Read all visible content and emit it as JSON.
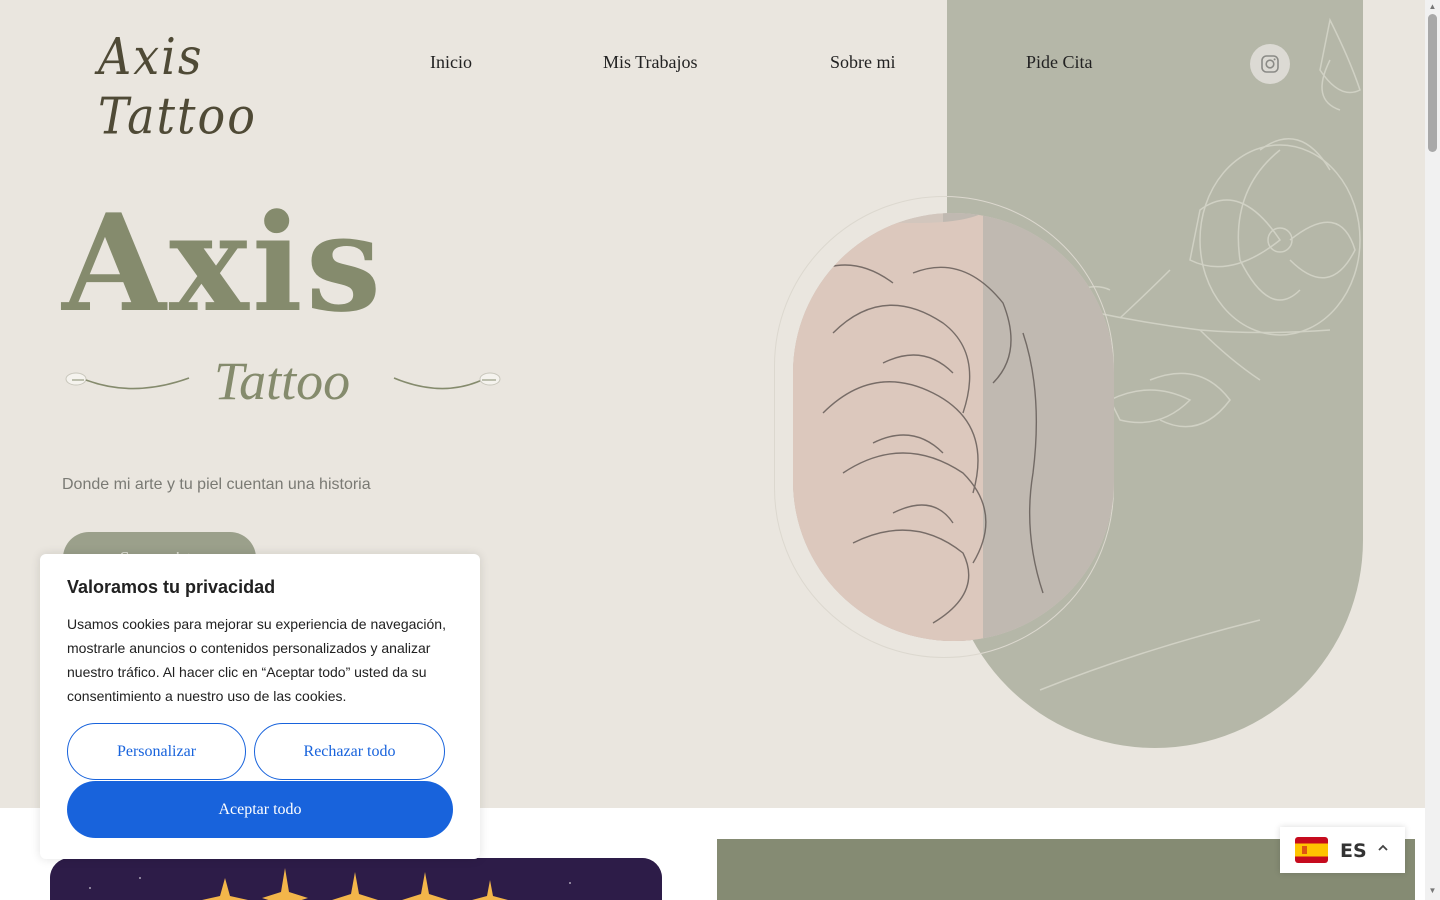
{
  "header": {
    "logo_text": "Axis Tattoo",
    "nav": [
      {
        "label": "Inicio"
      },
      {
        "label": "Mis Trabajos"
      },
      {
        "label": "Sobre mi"
      },
      {
        "label": "Pide Cita"
      }
    ],
    "social_icon": "instagram-icon"
  },
  "hero": {
    "title": "Axis",
    "subtitle_script": "Tattoo",
    "tagline": "Donde mi arte y tu piel cuentan una historia",
    "cta_label": "Sumergirte"
  },
  "cookie_banner": {
    "title": "Valoramos tu privacidad",
    "text": "Usamos cookies para mejorar su experiencia de navegación, mostrarle anuncios o contenidos personalizados y analizar nuestro tráfico. Al hacer clic en “Aceptar todo” usted da su consentimiento a nuestro uso de las cookies.",
    "customize_label": "Personalizar",
    "reject_label": "Rechazar todo",
    "accept_label": "Aceptar todo"
  },
  "language_switcher": {
    "code": "ES",
    "flag": "spain-flag-icon"
  },
  "colors": {
    "hero_bg": "#eae6df",
    "accent_green": "#858b6d",
    "panel_green": "#b5b7a8",
    "cookie_blue": "#1863dc"
  }
}
